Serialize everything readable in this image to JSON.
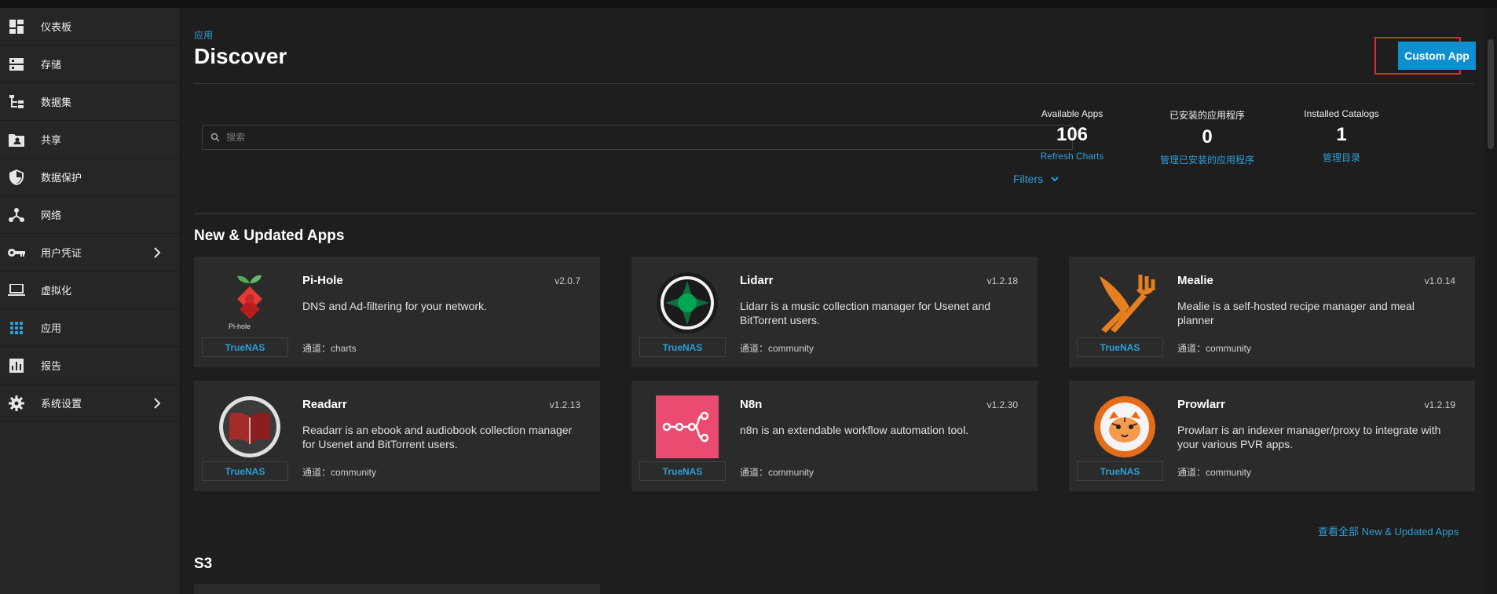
{
  "sidebar": {
    "items": [
      {
        "label": "仪表板",
        "icon": "dashboard-icon"
      },
      {
        "label": "存储",
        "icon": "storage-icon"
      },
      {
        "label": "数据集",
        "icon": "dataset-icon"
      },
      {
        "label": "共享",
        "icon": "share-icon"
      },
      {
        "label": "数据保护",
        "icon": "shield-icon"
      },
      {
        "label": "网络",
        "icon": "network-icon"
      },
      {
        "label": "用户凭证",
        "icon": "key-icon"
      },
      {
        "label": "虚拟化",
        "icon": "laptop-icon"
      },
      {
        "label": "应用",
        "icon": "apps-icon"
      },
      {
        "label": "报告",
        "icon": "report-icon"
      },
      {
        "label": "系统设置",
        "icon": "gear-icon"
      }
    ],
    "active_color": "#2d9fd8"
  },
  "header": {
    "breadcrumb": "应用",
    "title": "Discover",
    "custom_app_label": "Custom App"
  },
  "search": {
    "placeholder": "搜索",
    "filters_label": "Filters"
  },
  "stats": [
    {
      "label": "Available Apps",
      "value": "106",
      "link": "Refresh Charts"
    },
    {
      "label": "已安装的应用程序",
      "value": "0",
      "link": "管理已安装的应用程序"
    },
    {
      "label": "Installed Catalogs",
      "value": "1",
      "link": "管理目录"
    }
  ],
  "sections": {
    "new_updated": "New & Updated Apps",
    "view_all": "查看全部 New & Updated Apps",
    "s3": "S3"
  },
  "apps": [
    {
      "name": "Pi-Hole",
      "version": "v2.0.7",
      "description": "DNS and Ad-filtering for your network.",
      "catalog": "TrueNAS",
      "train": "通道：charts",
      "logo_text": "Pi-hole"
    },
    {
      "name": "Lidarr",
      "version": "v1.2.18",
      "description": "Lidarr is a music collection manager for Usenet and BitTorrent users.",
      "catalog": "TrueNAS",
      "train": "通道：community"
    },
    {
      "name": "Mealie",
      "version": "v1.0.14",
      "description": "Mealie is a self-hosted recipe manager and meal planner",
      "catalog": "TrueNAS",
      "train": "通道：community"
    },
    {
      "name": "Readarr",
      "version": "v1.2.13",
      "description": "Readarr is an ebook and audiobook collection manager for Usenet and BitTorrent users.",
      "catalog": "TrueNAS",
      "train": "通道：community"
    },
    {
      "name": "N8n",
      "version": "v1.2.30",
      "description": "n8n is an extendable workflow automation tool.",
      "catalog": "TrueNAS",
      "train": "通道：community"
    },
    {
      "name": "Prowlarr",
      "version": "v1.2.19",
      "description": "Prowlarr is an indexer manager/proxy to integrate with your various PVR apps.",
      "catalog": "TrueNAS",
      "train": "通道：community"
    }
  ],
  "colors": {
    "accent": "#2d9fd8",
    "button": "#0d8fd0",
    "highlight_outline": "#e02b2b",
    "mealie": "#e67e22",
    "n8n": "#ea4b71",
    "prowlarr": "#e66c1a"
  }
}
